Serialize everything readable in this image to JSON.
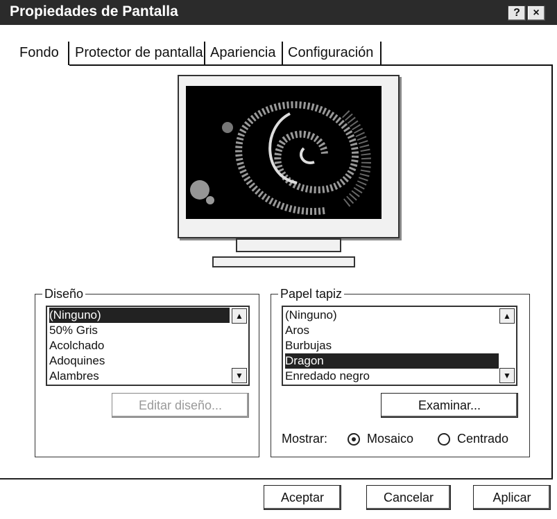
{
  "window": {
    "title": "Propiedades de Pantalla",
    "help_label": "?",
    "close_label": "×"
  },
  "tabs": [
    "Fondo",
    "Protector de pantalla",
    "Apariencia",
    "Configuración"
  ],
  "design": {
    "label": "Diseño",
    "items": [
      "(Ninguno)",
      "50% Gris",
      "Acolchado",
      "Adoquines",
      "Alambres"
    ],
    "selected_index": 0,
    "edit_button": "Editar diseño..."
  },
  "wallpaper": {
    "label": "Papel tapiz",
    "items": [
      "(Ninguno)",
      "Aros",
      "Burbujas",
      "Dragon",
      "Enredado negro"
    ],
    "selected_index": 3,
    "browse_button": "Examinar...",
    "display_label": "Mostrar:",
    "options": [
      "Mosaico",
      "Centrado"
    ],
    "selected_option": "Mosaico"
  },
  "buttons": {
    "ok": "Aceptar",
    "cancel": "Cancelar",
    "apply": "Aplicar"
  },
  "icons": {
    "scroll_up": "triangle-up",
    "scroll_down": "triangle-down",
    "radio_checked": "radio-dot"
  }
}
